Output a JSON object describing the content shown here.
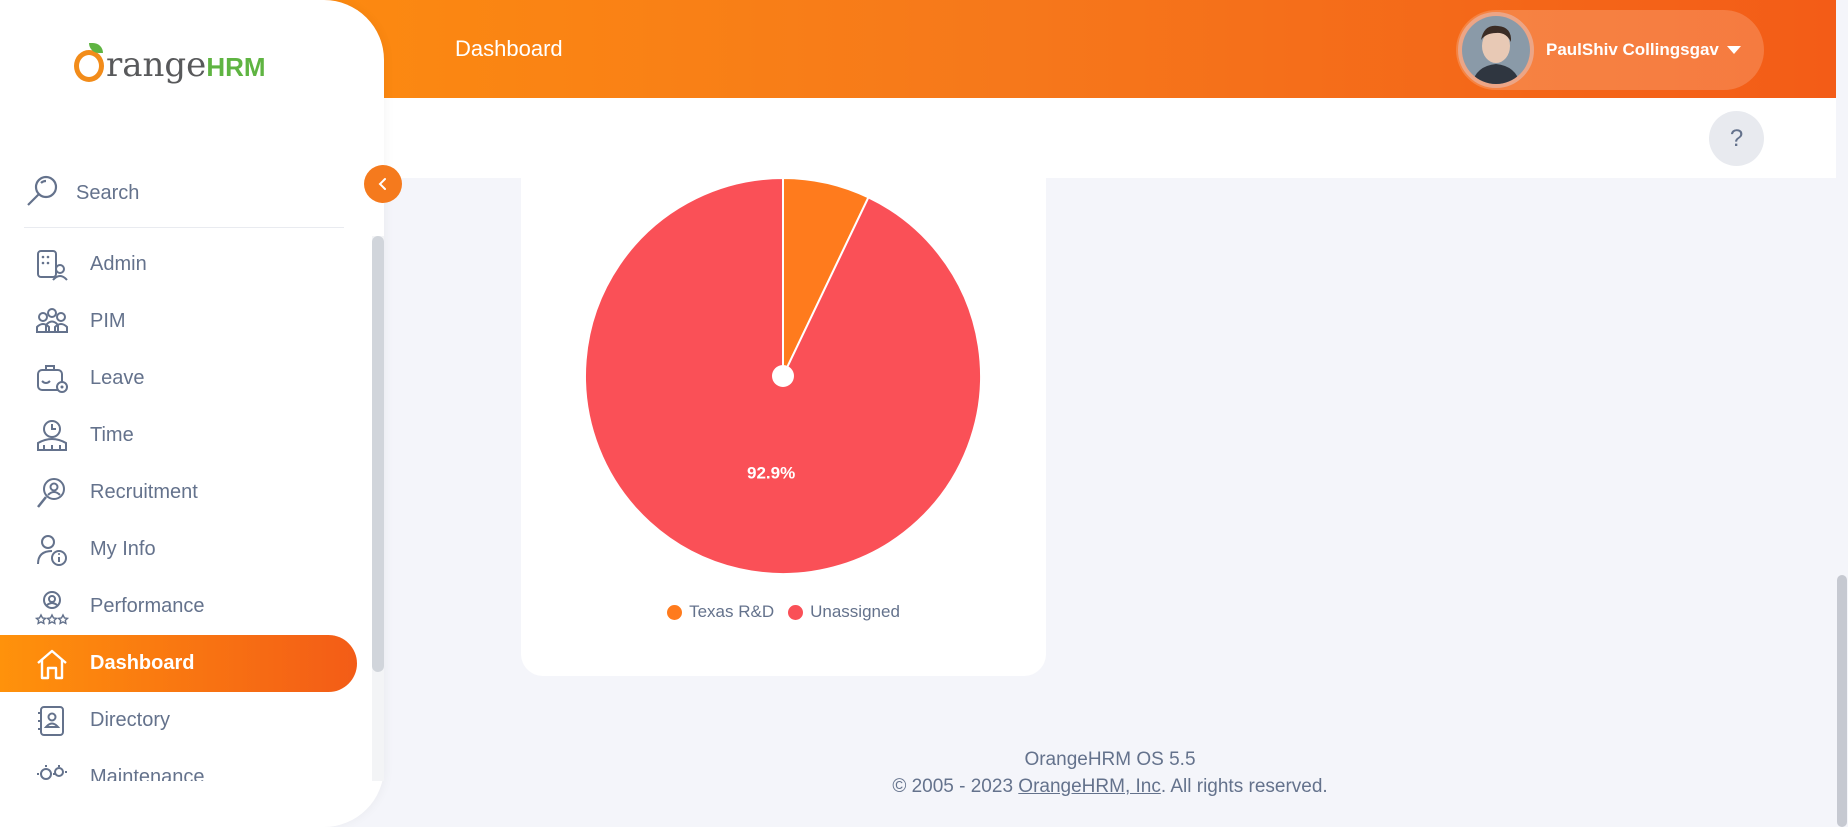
{
  "header": {
    "title": "Dashboard",
    "user_name": "PaulShiv Collingsgav",
    "help_label": "?"
  },
  "brand": {
    "main": "range",
    "hrm": "HRM"
  },
  "sidebar": {
    "search_placeholder": "Search",
    "items": [
      {
        "label": "Admin",
        "icon": "admin-icon",
        "active": false
      },
      {
        "label": "PIM",
        "icon": "pim-icon",
        "active": false
      },
      {
        "label": "Leave",
        "icon": "leave-icon",
        "active": false
      },
      {
        "label": "Time",
        "icon": "time-icon",
        "active": false
      },
      {
        "label": "Recruitment",
        "icon": "recruitment-icon",
        "active": false
      },
      {
        "label": "My Info",
        "icon": "my-info-icon",
        "active": false
      },
      {
        "label": "Performance",
        "icon": "performance-icon",
        "active": false
      },
      {
        "label": "Dashboard",
        "icon": "home-icon",
        "active": true
      },
      {
        "label": "Directory",
        "icon": "directory-icon",
        "active": false
      },
      {
        "label": "Maintenance",
        "icon": "maintenance-icon",
        "active": false
      }
    ]
  },
  "colors": {
    "accent": "#f57a1d",
    "slice_texas": "#ff7b1d",
    "slice_unassigned": "#fa5057"
  },
  "chart_data": {
    "type": "pie",
    "categories": [
      "Texas R&D",
      "Unassigned"
    ],
    "values": [
      7.1,
      92.9
    ],
    "data_labels": [
      "",
      "92.9%"
    ],
    "legend_position": "bottom"
  },
  "legend": {
    "items": [
      {
        "label": "Texas R&D",
        "color": "#ff7b1d"
      },
      {
        "label": "Unassigned",
        "color": "#fa5057"
      }
    ]
  },
  "footer": {
    "version": "OrangeHRM OS 5.5",
    "copyright_prefix": "© 2005 - 2023 ",
    "company_link": "OrangeHRM, Inc",
    "copyright_suffix": ". All rights reserved."
  }
}
